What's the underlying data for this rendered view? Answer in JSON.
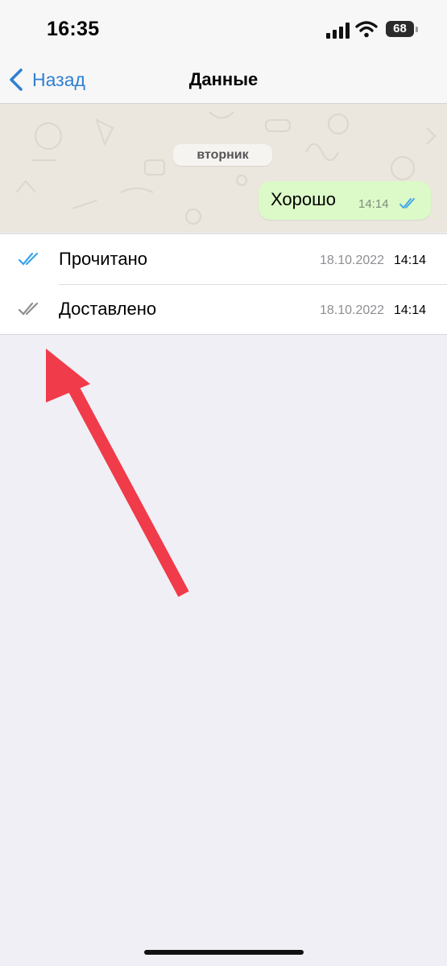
{
  "status_bar": {
    "time": "16:35",
    "battery": "68",
    "icons": [
      "signal-icon",
      "wifi-icon",
      "battery-icon"
    ]
  },
  "nav": {
    "back_label": "Назад",
    "title": "Данные",
    "accent_color": "#2f80d2"
  },
  "chat": {
    "date_label": "вторник",
    "message": {
      "text": "Хорошо",
      "time": "14:14",
      "status_icon": "double-check-icon"
    }
  },
  "receipts": [
    {
      "label": "Прочитано",
      "date": "18.10.2022",
      "time": "14:14",
      "icon": "read-double-check-icon",
      "icon_color": "#3aa3e8"
    },
    {
      "label": "Доставлено",
      "date": "18.10.2022",
      "time": "14:14",
      "icon": "delivered-double-check-icon",
      "icon_color": "#8e8e93"
    }
  ],
  "annotation": {
    "type": "red-arrow-icon",
    "color": "#f03b4a"
  }
}
